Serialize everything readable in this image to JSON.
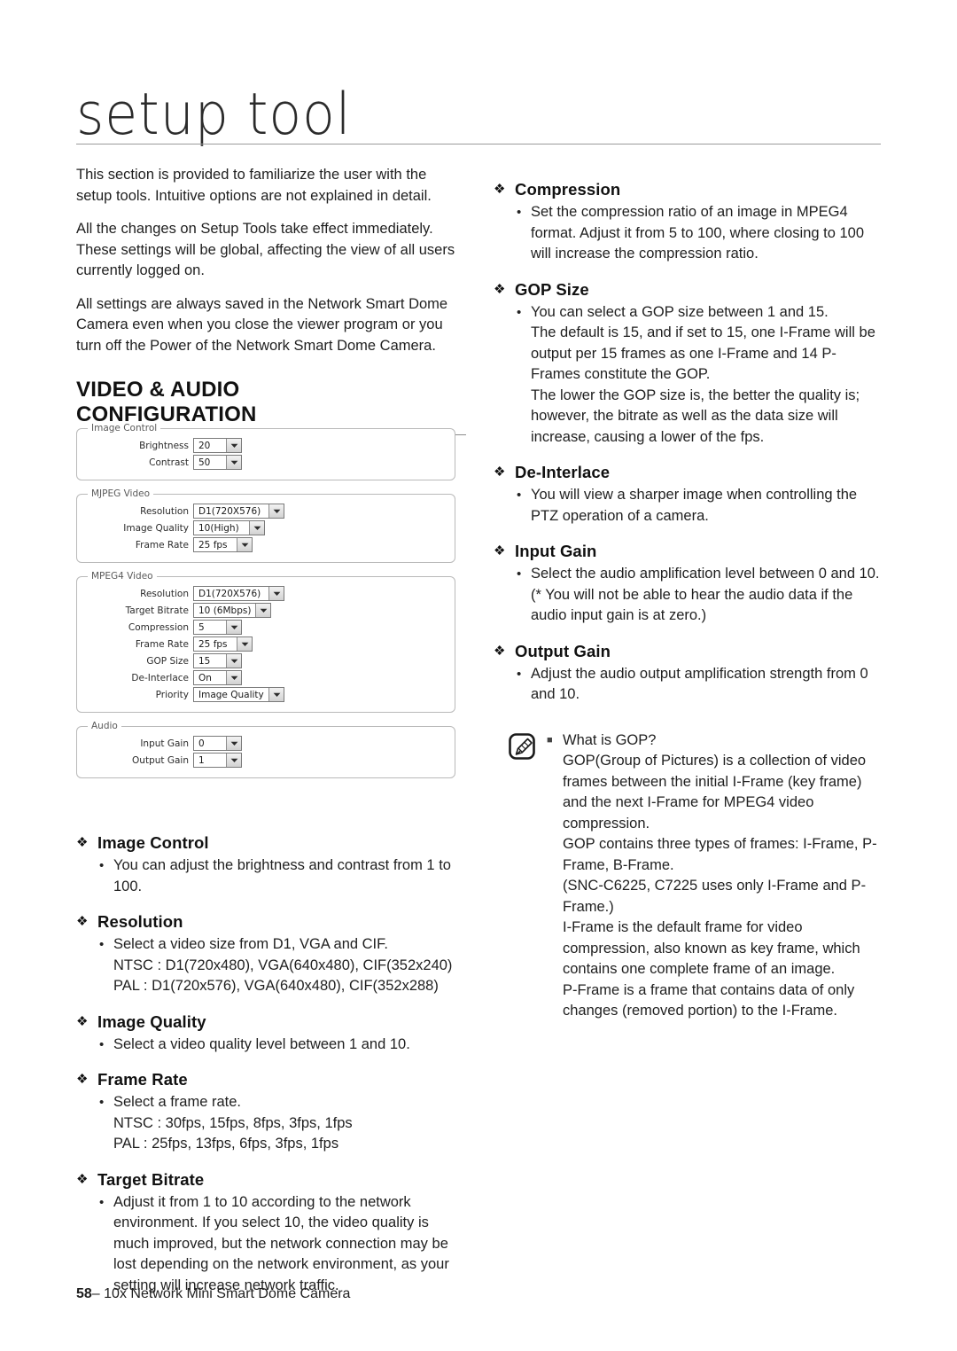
{
  "header": {
    "title": "setup tool"
  },
  "intro": {
    "paragraphs": [
      "This section is provided to familiarize the user with the setup tools. Intuitive options are not explained in detail.",
      "All the changes on Setup Tools take effect immediately. These settings will be global, affecting the view of all users currently logged on.",
      "All settings are always saved in the Network Smart Dome Camera even when you close the viewer program or you turn off the Power of the Network Smart Dome Camera."
    ]
  },
  "section": {
    "heading_line1": "VIDEO & AUDIO",
    "heading_line2": "CONFIGURATION"
  },
  "figure": {
    "groups": [
      {
        "legend": "Image Control",
        "rows": [
          {
            "label": "Brightness",
            "value": "20",
            "size": "w-xs"
          },
          {
            "label": "Contrast",
            "value": "50",
            "size": "w-xs"
          }
        ]
      },
      {
        "legend": "MJPEG Video",
        "rows": [
          {
            "label": "Resolution",
            "value": "D1(720X576)",
            "size": "w-lg"
          },
          {
            "label": "Image Quality",
            "value": "10(High)",
            "size": "w-md"
          },
          {
            "label": "Frame Rate",
            "value": "25 fps",
            "size": "w-sm"
          }
        ]
      },
      {
        "legend": "MPEG4 Video",
        "rows": [
          {
            "label": "Resolution",
            "value": "D1(720X576)",
            "size": "w-lg"
          },
          {
            "label": "Target Bitrate",
            "value": "10 (6Mbps)",
            "size": "w-md"
          },
          {
            "label": "Compression",
            "value": "5",
            "size": "w-xs"
          },
          {
            "label": "Frame Rate",
            "value": "25 fps",
            "size": "w-sm"
          },
          {
            "label": "GOP Size",
            "value": "15",
            "size": "w-xs"
          },
          {
            "label": "De-Interlace",
            "value": "On",
            "size": "w-xs"
          },
          {
            "label": "Priority",
            "value": "Image Quality",
            "size": "w-lg"
          }
        ]
      },
      {
        "legend": "Audio",
        "rows": [
          {
            "label": "Input Gain",
            "value": "0",
            "size": "w-xs"
          },
          {
            "label": "Output Gain",
            "value": "1",
            "size": "w-xs"
          }
        ]
      }
    ]
  },
  "left_topics": [
    {
      "title": "Image Control",
      "body": "You can adjust the brightness and contrast from 1 to 100."
    },
    {
      "title": "Resolution",
      "body": "Select a video size from D1, VGA and CIF.\nNTSC : D1(720x480), VGA(640x480), CIF(352x240)\nPAL : D1(720x576), VGA(640x480), CIF(352x288)"
    },
    {
      "title": "Image Quality",
      "body": "Select a video quality level between 1 and 10."
    },
    {
      "title": "Frame Rate",
      "body": "Select a frame rate.\nNTSC : 30fps, 15fps, 8fps, 3fps, 1fps\nPAL : 25fps, 13fps, 6fps, 3fps, 1fps"
    },
    {
      "title": "Target Bitrate",
      "body": "Adjust it from 1 to 10 according to the network environment. If you select 10, the video quality is much improved, but the network connection may be lost depending on the network environment, as your setting will increase network traffic."
    }
  ],
  "right_topics": [
    {
      "title": "Compression",
      "body": "Set the compression ratio of an image in MPEG4 format. Adjust it from 5 to 100, where closing to 100 will increase the compression ratio."
    },
    {
      "title": "GOP Size",
      "body": "You can select a GOP size between 1 and 15.\nThe default is 15, and if set to 15, one I-Frame will be output per 15 frames as one I-Frame and 14 P-Frames constitute the GOP.\nThe lower the GOP size is, the better the quality is; however, the bitrate as well as the data size will increase, causing a lower of the fps."
    },
    {
      "title": "De-Interlace",
      "body": "You will view a sharper image when controlling the PTZ operation of a camera."
    },
    {
      "title": "Input Gain",
      "body": "Select the audio amplification level between 0 and 10.\n(* You will not be able to hear the audio data if the audio input gain is at zero.)"
    },
    {
      "title": "Output Gain",
      "body": "Adjust the audio output amplification strength from 0 and 10."
    }
  ],
  "note": {
    "title": "What is GOP?",
    "text": "GOP(Group of Pictures) is a collection of video frames between the initial I-Frame (key frame) and the next I-Frame for MPEG4 video compression.\nGOP contains three types of frames: I-Frame, P-Frame, B-Frame.\n(SNC-C6225, C7225 uses only I-Frame and P-Frame.)\nI-Frame is the default frame for video compression, also known as key frame, which contains one complete frame of an image.\nP-Frame is a frame that contains data of only changes (removed portion) to the I-Frame."
  },
  "glyphs": {
    "diamond": "❖",
    "dot": "•",
    "square": "■"
  },
  "footer": {
    "page": "58",
    "dash": "–",
    "doc_title": "10x Network Mini Smart Dome Camera"
  },
  "colors": {
    "text": "#1f1f1f",
    "rule": "#8c8c8c",
    "panel_border": "#b9b9b9",
    "control_border": "#7a7a7a"
  }
}
